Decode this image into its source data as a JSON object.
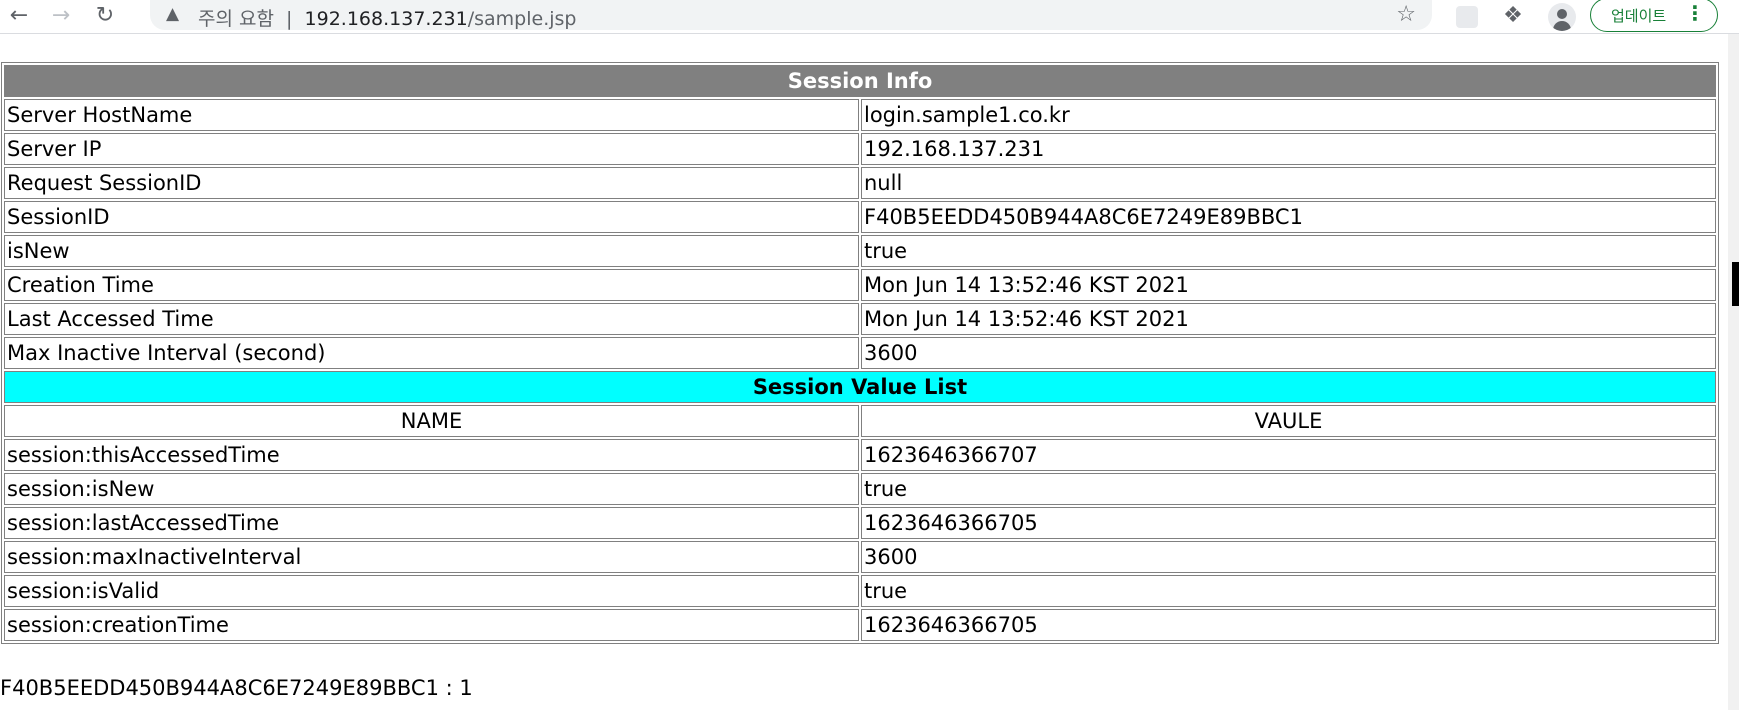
{
  "browser": {
    "security_label": "주의 요함",
    "url_host": "192.168.137.231",
    "url_path": "/sample.jsp",
    "update_label": "업데이트"
  },
  "session_info": {
    "title": "Session Info",
    "rows": [
      {
        "key": "Server HostName",
        "value": "login.sample1.co.kr"
      },
      {
        "key": "Server IP",
        "value": "192.168.137.231"
      },
      {
        "key": "Request SessionID",
        "value": "null"
      },
      {
        "key": "SessionID",
        "value": "F40B5EEDD450B944A8C6E7249E89BBC1"
      },
      {
        "key": "isNew",
        "value": "true"
      },
      {
        "key": "Creation Time",
        "value": "Mon Jun 14 13:52:46 KST 2021"
      },
      {
        "key": "Last Accessed Time",
        "value": "Mon Jun 14 13:52:46 KST 2021"
      },
      {
        "key": "Max Inactive Interval (second)",
        "value": "3600"
      }
    ]
  },
  "session_values": {
    "title": "Session Value List",
    "col_name": "NAME",
    "col_value": "VAULE",
    "rows": [
      {
        "key": "session:thisAccessedTime",
        "value": "1623646366707"
      },
      {
        "key": "session:isNew",
        "value": "true"
      },
      {
        "key": "session:lastAccessedTime",
        "value": "1623646366705"
      },
      {
        "key": "session:maxInactiveInterval",
        "value": "3600"
      },
      {
        "key": "session:isValid",
        "value": "true"
      },
      {
        "key": "session:creationTime",
        "value": "1623646366705"
      }
    ]
  },
  "footer": "F40B5EEDD450B944A8C6E7249E89BBC1 : 1",
  "colors": {
    "header_gray": "#808080",
    "header_cyan": "#00ffff",
    "update_green": "#188038"
  },
  "icons": [
    "back-icon",
    "forward-icon",
    "reload-icon",
    "warning-icon",
    "star-icon",
    "extension-icon",
    "puzzle-icon",
    "profile-icon",
    "more-icon"
  ]
}
